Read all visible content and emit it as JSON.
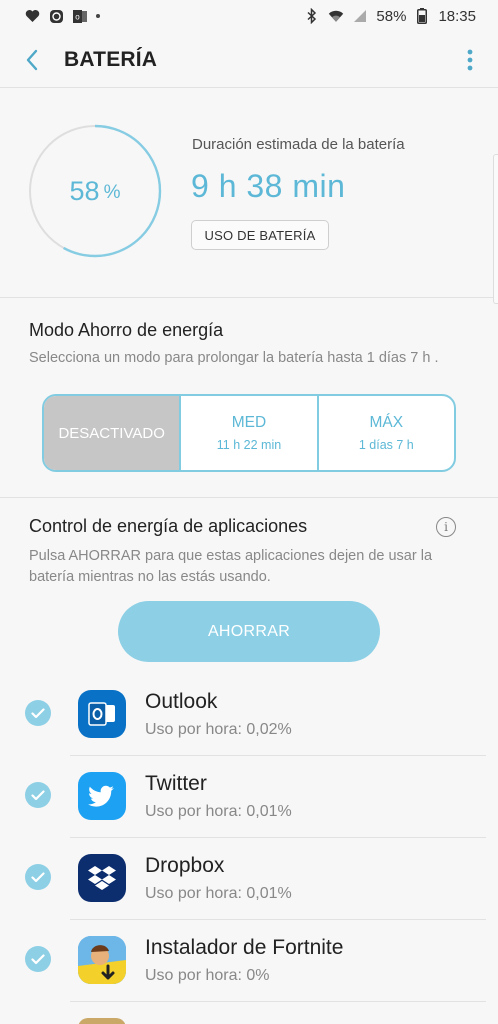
{
  "status_bar": {
    "battery_percent": "58%",
    "time": "18:35",
    "left_icons": [
      "heart-icon",
      "whatsapp-icon",
      "outlook-icon"
    ],
    "right_icons": [
      "bluetooth-icon",
      "wifi-icon",
      "signal-icon",
      "battery-icon"
    ]
  },
  "app_bar": {
    "title": "BATERÍA"
  },
  "summary": {
    "percent_value": "58",
    "percent_unit": "%",
    "percent_level": 0.58,
    "estimate_label": "Duración estimada de la batería",
    "estimate_value": "9 h 38 min",
    "usage_button": "USO DE BATERÍA"
  },
  "power_saving": {
    "title": "Modo Ahorro de energía",
    "subtitle": "Selecciona un modo para prolongar la batería hasta 1 días 7 h .",
    "modes": [
      {
        "label": "DESACTIVADO",
        "sub": "",
        "active": true
      },
      {
        "label": "MED",
        "sub": "11 h 22 min",
        "active": false
      },
      {
        "label": "MÁX",
        "sub": "1 días 7 h",
        "active": false
      }
    ]
  },
  "app_power": {
    "title": "Control de energía de aplicaciones",
    "subtitle_line1": "Pulsa AHORRAR para que estas aplicaciones dejen de usar la",
    "subtitle_line2": "batería mientras no las estás usando.",
    "save_button": "AHORRAR",
    "apps": [
      {
        "name": "Outlook",
        "usage": "Uso por hora: 0,02%",
        "icon": "outlook-icon",
        "color": "#0a72c6"
      },
      {
        "name": "Twitter",
        "usage": "Uso por hora: 0,01%",
        "icon": "twitter-icon",
        "color": "#1da1f2"
      },
      {
        "name": "Dropbox",
        "usage": "Uso por hora: 0,01%",
        "icon": "dropbox-icon",
        "color": "#0d2e6e"
      },
      {
        "name": "Instalador de Fortnite",
        "usage": "Uso por hora: 0%",
        "icon": "fortnite-icon",
        "color": "#f4d12a"
      }
    ]
  },
  "colors": {
    "accent": "#5cb8d6",
    "button": "#8dd0e6",
    "inactive_mode": "#c6c6c6"
  }
}
